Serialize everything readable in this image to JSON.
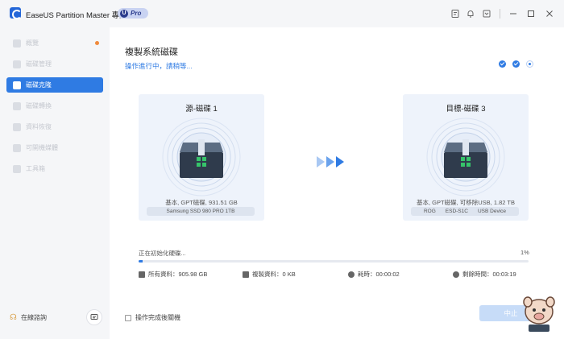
{
  "app": {
    "title": "EaseUS Partition Master 專業版",
    "badge_u": "U",
    "badge": "Pro"
  },
  "titlebar_icons": [
    "feedback-icon",
    "bell-icon",
    "dropdown-icon",
    "minimize-icon",
    "maximize-icon",
    "close-icon"
  ],
  "sidebar": {
    "items": [
      {
        "label": "概覽",
        "active": false,
        "badge": true
      },
      {
        "label": "磁碟管理",
        "active": false
      },
      {
        "label": "磁碟克隆",
        "active": true
      },
      {
        "label": "磁碟轉換",
        "active": false
      },
      {
        "label": "資料恢復",
        "active": false
      },
      {
        "label": "可開機媒體",
        "active": false
      },
      {
        "label": "工具箱",
        "active": false
      }
    ],
    "online_help": "在線諮詢"
  },
  "main": {
    "title": "複製系統磁碟",
    "subtitle": "操作進行中，請稍等...",
    "steps": [
      "done",
      "done",
      "current"
    ],
    "source": {
      "label": "源-磁碟 1",
      "info": "基本, GPT磁碟, 931.51 GB",
      "tags": [
        "Samsung SSD 980 PRO 1TB"
      ]
    },
    "target": {
      "label": "目標-磁碟 3",
      "info": "基本, GPT磁碟, 可移除USB, 1.82 TB",
      "tags": [
        "ROG",
        "ESD-S1C",
        "USB Device"
      ]
    },
    "progress": {
      "status": "正在初始化硬碟...",
      "percent_label": "1%",
      "value": 0.01
    },
    "stats": {
      "total": "所有資料：905.98 GB",
      "copied": "複製資料：0 KB",
      "elapsed": "耗時：00:00:02",
      "remaining": "剩餘時間：00:03:19"
    },
    "shutdown_label": "操作完成後關機",
    "cancel_label": "中止"
  },
  "colors": {
    "accent": "#2f7be3",
    "sidebar_bg": "#f5f6f8",
    "card_bg": "#eef3fb"
  }
}
